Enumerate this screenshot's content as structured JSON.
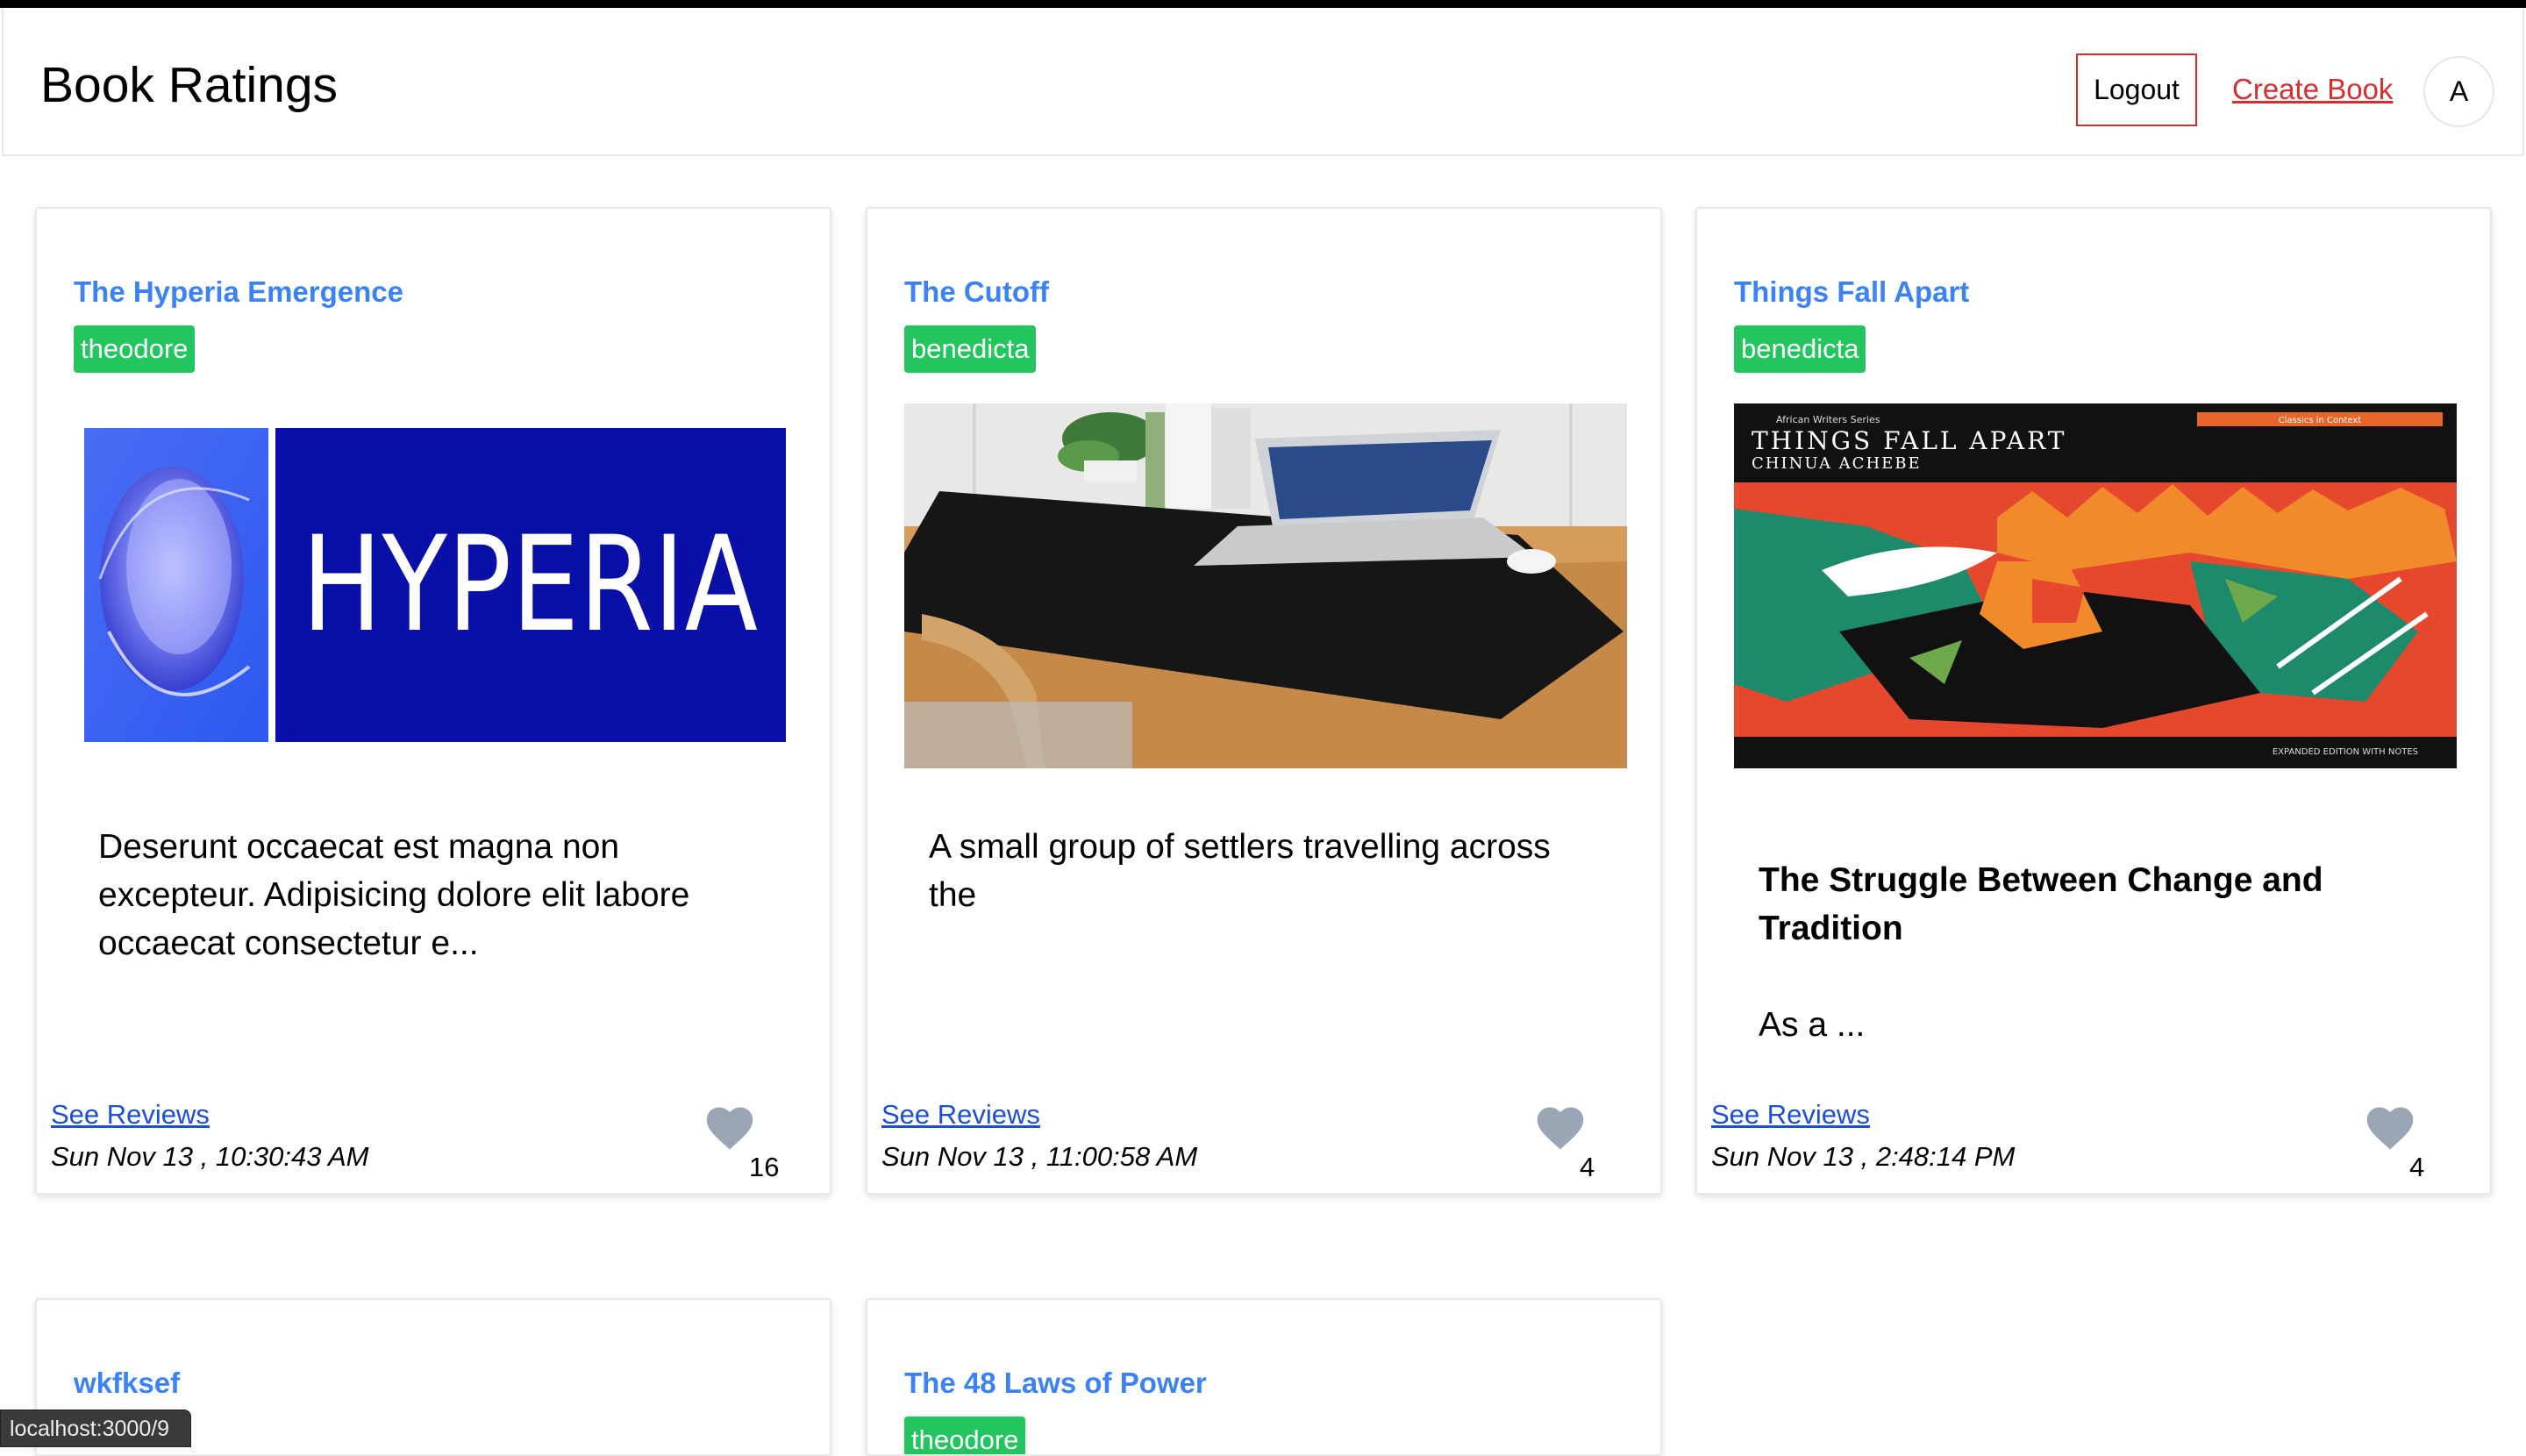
{
  "header": {
    "brand": "Book Ratings",
    "logout_label": "Logout",
    "create_label": "Create Book",
    "avatar_initial": "A"
  },
  "cards": [
    {
      "title": "The Hyperia Emergence",
      "author": "theodore",
      "image": "hyperia-logo",
      "excerpt_heading": "",
      "excerpt": "Deserunt occaecat est magna non excepteur. Adipisicing dolore elit labore occaecat consectetur e...",
      "see_reviews": "See Reviews",
      "date": "Sun Nov 13 , 10:30:43 AM",
      "likes": "16"
    },
    {
      "title": "The Cutoff",
      "author": "benedicta",
      "image": "desk-laptop-photo",
      "excerpt_heading": "",
      "excerpt": "A small group of settlers travelling across the",
      "see_reviews": "See Reviews",
      "date": "Sun Nov 13 , 11:00:58 AM",
      "likes": "4"
    },
    {
      "title": "Things Fall Apart",
      "author": "benedicta",
      "image": "things-fall-apart-cover",
      "cover_series": "African Writers Series",
      "cover_classics": "Classics in Context",
      "cover_title": "THINGS FALL APART",
      "cover_author": "CHINUA ACHEBE",
      "cover_edition": "EXPANDED EDITION WITH NOTES",
      "excerpt_heading": "The Struggle Between Change and Tradition",
      "excerpt": "As a ...",
      "see_reviews": "See Reviews",
      "date": "Sun Nov 13 , 2:48:14 PM",
      "likes": "4"
    },
    {
      "title": "wkfksef"
    },
    {
      "title": "The 48 Laws of Power",
      "author": "theodore"
    }
  ],
  "hyperia_text": "HYPERIA",
  "status_tooltip": "localhost:3000/9",
  "colors": {
    "accent_red": "#d32f2f",
    "title_blue": "#3b82f6",
    "badge_green": "#22c55e",
    "link_blue": "#1d4ed8",
    "heart_gray": "#9aa6b5"
  }
}
